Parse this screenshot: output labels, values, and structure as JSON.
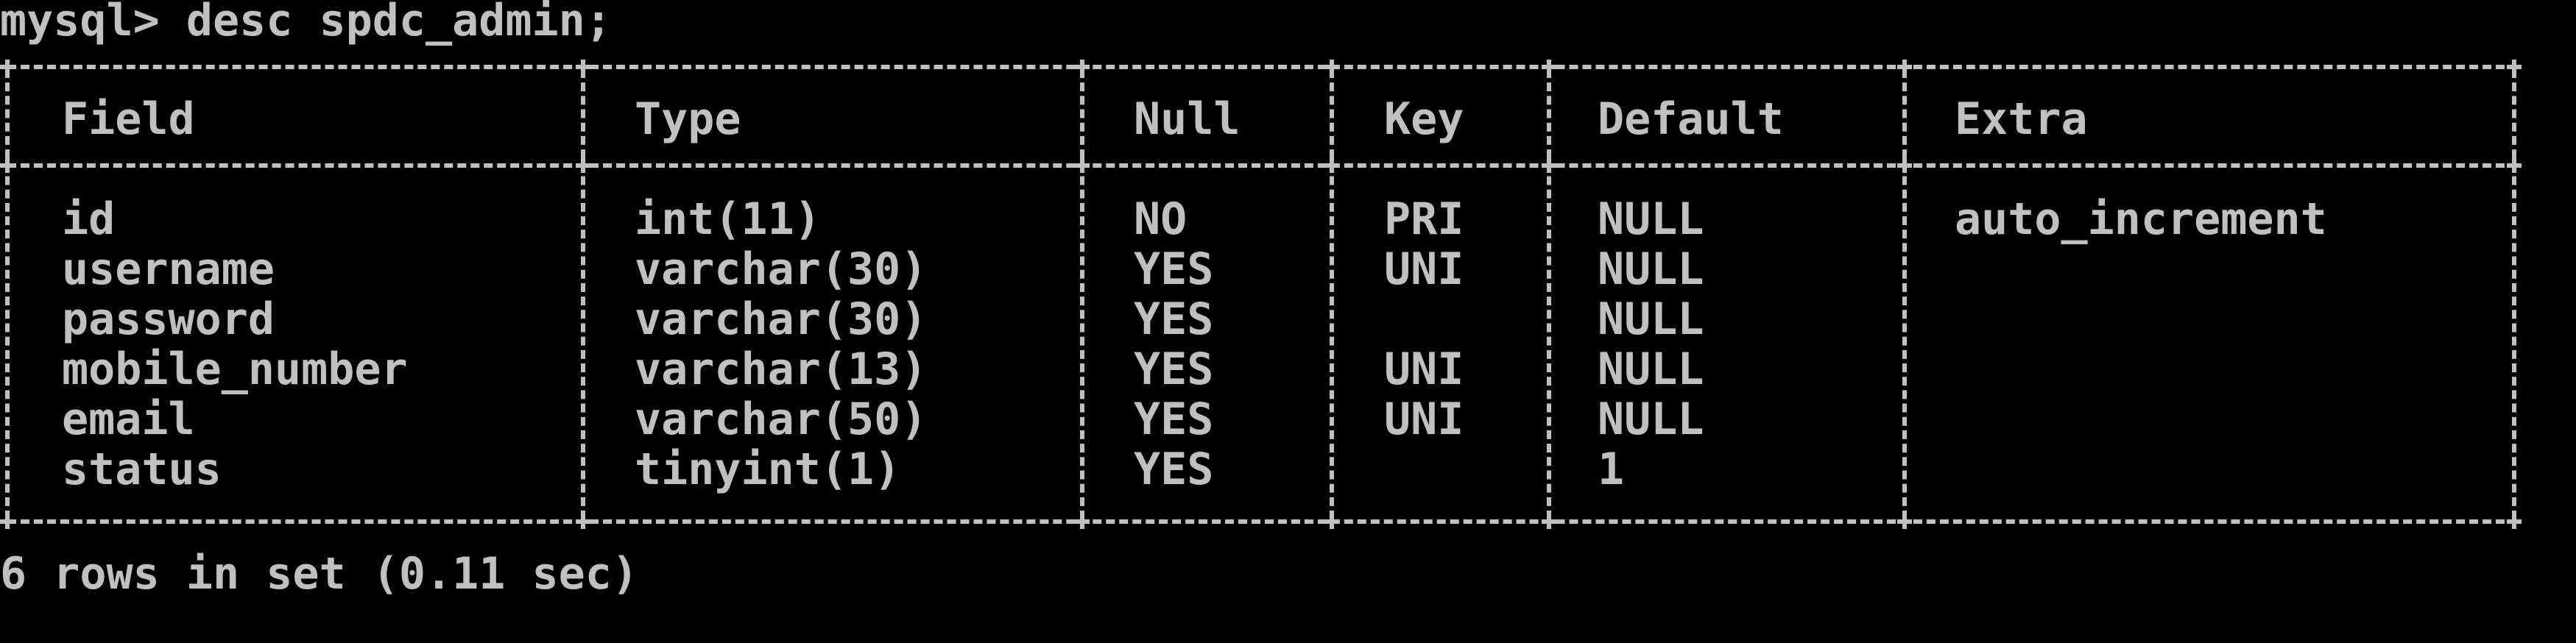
{
  "terminal": {
    "prompt": "mysql> desc spdc_admin;",
    "footer": "6 rows in set (0.11 sec)"
  },
  "table": {
    "columns": [
      "Field",
      "Type",
      "Null",
      "Key",
      "Default",
      "Extra"
    ],
    "rows": [
      [
        "id",
        "int(11)",
        "NO",
        "PRI",
        "NULL",
        "auto_increment"
      ],
      [
        "username",
        "varchar(30)",
        "YES",
        "UNI",
        "NULL",
        ""
      ],
      [
        "password",
        "varchar(30)",
        "YES",
        "",
        "NULL",
        ""
      ],
      [
        "mobile_number",
        "varchar(13)",
        "YES",
        "UNI",
        "NULL",
        ""
      ],
      [
        "email",
        "varchar(50)",
        "YES",
        "UNI",
        "NULL",
        ""
      ],
      [
        "status",
        "tinyint(1)",
        "YES",
        "",
        "1",
        ""
      ]
    ]
  },
  "colors": {
    "background": "#000000",
    "text": "#c0c0c0"
  }
}
